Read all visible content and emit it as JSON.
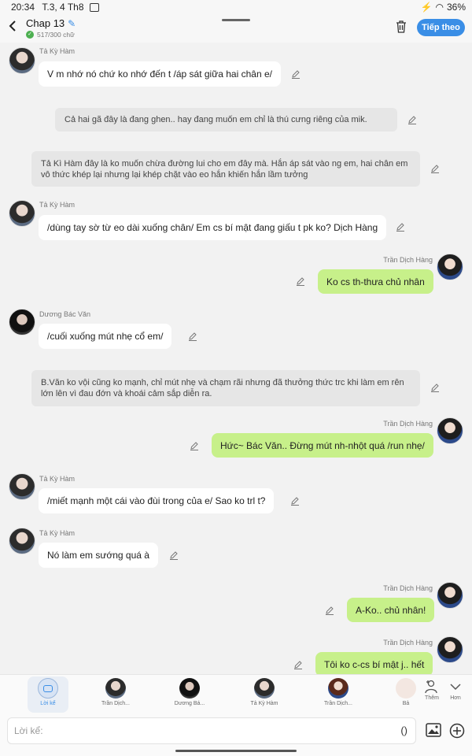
{
  "status_bar": {
    "time": "20:34",
    "date": "T.3, 4 Th8",
    "battery": "36%"
  },
  "header": {
    "title": "Chap 13",
    "word_count": "517/300 chữ",
    "next_label": "Tiếp theo"
  },
  "messages": [
    {
      "type": "other",
      "name": "Tả Kỳ Hàm",
      "text": "V m nhớ nó chứ ko nhớ đến t /áp sát giữa hai chân e/"
    },
    {
      "type": "narration",
      "text": "Cả hai gã đây là đang ghen.. hay đang muốn em chỉ là thú cưng riêng của mik."
    },
    {
      "type": "narration",
      "text": "Tả Kì Hàm đây là ko muốn chừa đường lui cho em đây mà. Hắn áp sát vào ng em, hai chân em vô thức khép lại nhưng lại khép chặt vào eo hắn khiến hắn lầm tưởng"
    },
    {
      "type": "other",
      "name": "Tả Kỳ Hàm",
      "text": "/dùng tay sờ từ eo dài xuống chân/ Em cs bí mật đang giấu t pk ko? Dịch Hàng"
    },
    {
      "type": "me",
      "name": "Trần Dịch Hàng",
      "text": "Ko cs th-thưa chủ nhân"
    },
    {
      "type": "other",
      "name": "Dương Bác Văn",
      "text": "/cuối xuống mút nhẹ cổ em/"
    },
    {
      "type": "narration",
      "text": "B.Văn ko vội cũng ko mạnh, chỉ mút nhẹ và chạm rãi nhưng đã thưởng thức trc khi làm em rên lớn lên vì đau đớn và khoái cảm sắp diễn ra."
    },
    {
      "type": "me",
      "name": "Trần Dịch Hàng",
      "text": "Hức~ Bác Văn.. Đừng mút nh-nhột quá /run nhẹ/"
    },
    {
      "type": "other",
      "name": "Tả Kỳ Hàm",
      "text": "/miết mạnh một cái vào đùi trong của e/ Sao ko trl t?"
    },
    {
      "type": "other",
      "name": "Tả Kỳ Hàm",
      "text": "Nó làm em sướng quá à"
    },
    {
      "type": "me",
      "name": "Trần Dịch Hàng",
      "text": "A-Ko.. chủ nhân!"
    },
    {
      "type": "me",
      "name": "Trần Dịch Hàng",
      "text": "Tôi ko c-cs bí mật j.. hết"
    }
  ],
  "characters": [
    {
      "label": "Lời kể"
    },
    {
      "label": "Trần Dịch..."
    },
    {
      "label": "Dương Bá..."
    },
    {
      "label": "Tả Kỳ Hàm"
    },
    {
      "label": "Trần Dịch..."
    },
    {
      "label": "Bả"
    }
  ],
  "tools": {
    "add_label": "Thêm",
    "more_label": "Hơn"
  },
  "input": {
    "placeholder": "Lời kể:",
    "paren": "()"
  },
  "icons": {
    "back": "chevron-left-icon",
    "edit": "pencil-icon",
    "trash": "trash-icon",
    "image": "image-icon",
    "plus": "plus-circle-icon"
  },
  "colors": {
    "accent": "#3a8ee6",
    "my_bubble": "#c7f08a",
    "narration_bg": "#e6e6e6"
  }
}
